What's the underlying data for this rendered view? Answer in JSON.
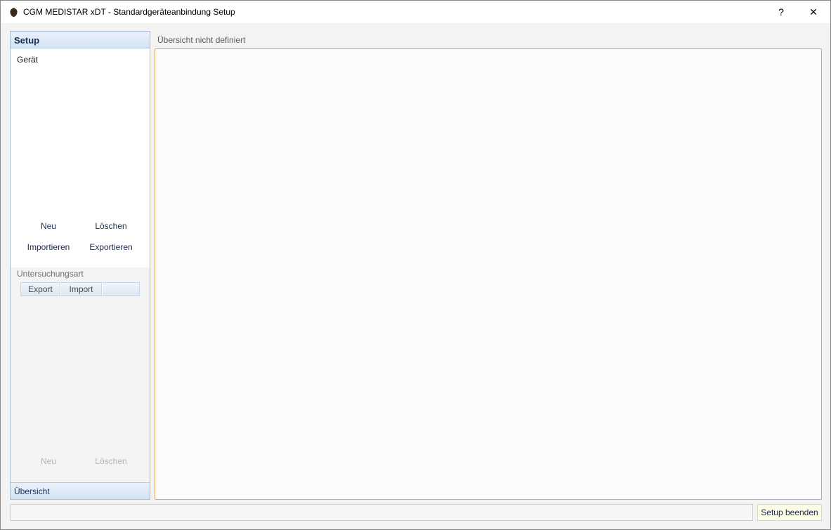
{
  "window": {
    "title": "CGM MEDISTAR xDT - Standardgeräteanbindung  Setup",
    "help_label": "?",
    "close_label": "✕"
  },
  "nav": {
    "header": "Setup",
    "devices": [
      "Gerät"
    ],
    "device_actions": {
      "new": "Neu",
      "delete": "Löschen",
      "import": "Importieren",
      "export": "Exportieren"
    },
    "examination": {
      "label": "Untersuchungsart",
      "tabs": [
        "Export",
        "Import",
        ""
      ],
      "new": "Neu",
      "delete": "Löschen"
    },
    "footer": "Übersicht"
  },
  "main": {
    "label": "Übersicht nicht definiert"
  },
  "statusbar": {
    "status_text": "",
    "finish_button": "Setup beenden"
  },
  "colors": {
    "nav_header": "#15315a",
    "panel_border": "#e2a65a",
    "disabled_text": "#b4b4b4"
  }
}
